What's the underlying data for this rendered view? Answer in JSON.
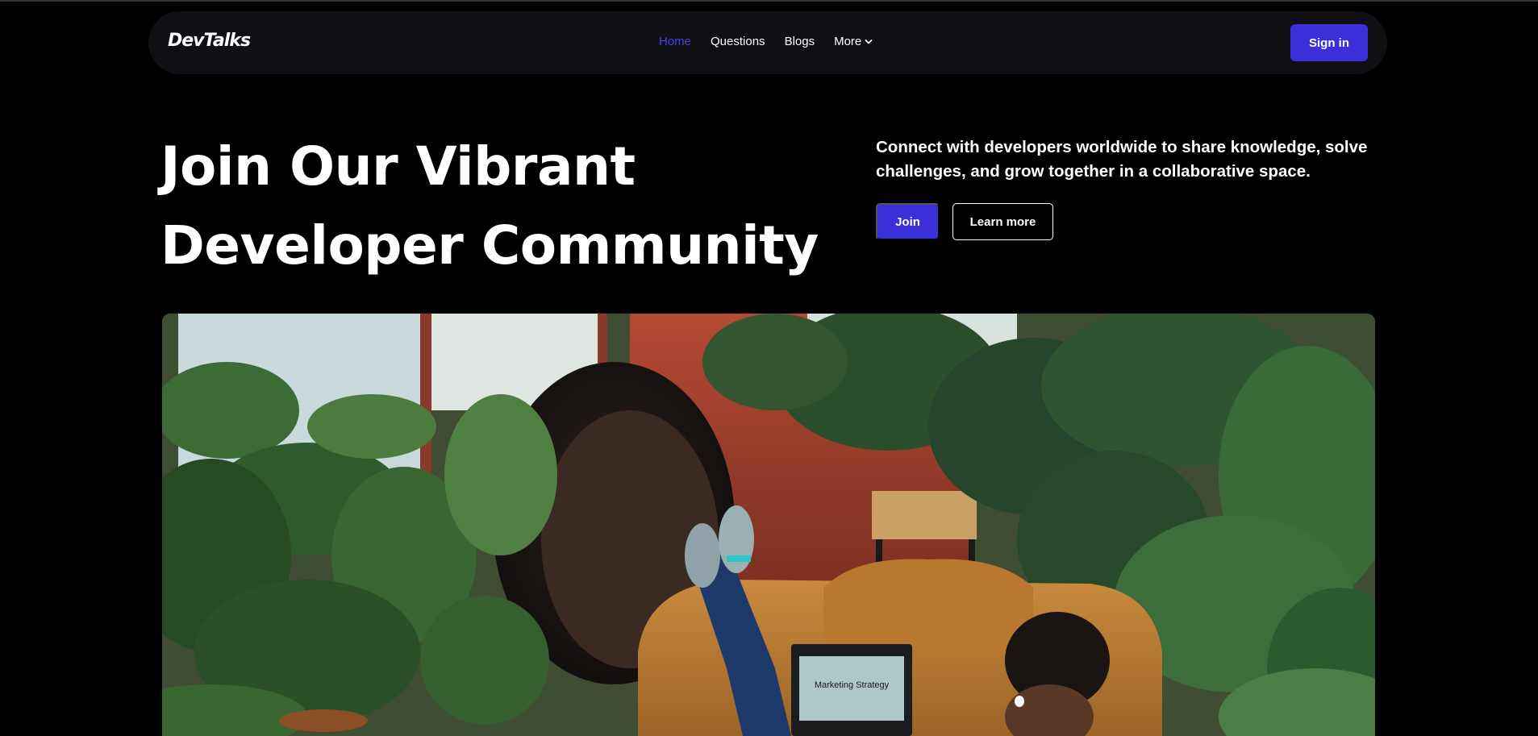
{
  "brand": {
    "name": "DevTalks"
  },
  "nav": {
    "items": [
      {
        "label": "Home",
        "active": true
      },
      {
        "label": "Questions",
        "active": false
      },
      {
        "label": "Blogs",
        "active": false
      },
      {
        "label": "More",
        "active": false,
        "has_dropdown": true
      }
    ],
    "signin_label": "Sign in"
  },
  "hero": {
    "title": "Join Our Vibrant Developer Community",
    "description": "Connect with developers worldwide to share knowledge, solve challenges, and grow together in a collaborative space.",
    "join_label": "Join",
    "learn_more_label": "Learn more",
    "image": {
      "laptop_screen_text": "Marketing Strategy"
    }
  },
  "colors": {
    "accent": "#3a2fd9",
    "active_link": "#4b3fe6",
    "background": "#000000",
    "navbar_bg": "#101014"
  },
  "icons": {
    "more_dropdown": "chevron-down-icon"
  }
}
